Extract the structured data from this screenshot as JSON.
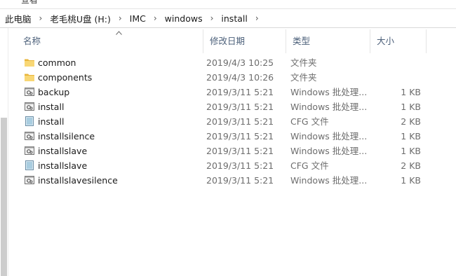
{
  "window": {
    "top_clipped_text": "查看"
  },
  "breadcrumb": {
    "items": [
      "此电脑",
      "老毛桃U盘 (H:)",
      "IMC",
      "windows",
      "install"
    ]
  },
  "columns": {
    "name": "名称",
    "date": "修改日期",
    "type": "类型",
    "size": "大小"
  },
  "files": [
    {
      "icon": "folder-icon",
      "name": "common",
      "date": "2019/4/3 10:25",
      "type": "文件夹",
      "size": ""
    },
    {
      "icon": "folder-icon",
      "name": "components",
      "date": "2019/4/3 10:26",
      "type": "文件夹",
      "size": ""
    },
    {
      "icon": "batch-file-icon",
      "name": "backup",
      "date": "2019/3/11 5:21",
      "type": "Windows 批处理...",
      "size": "1 KB"
    },
    {
      "icon": "batch-file-icon",
      "name": "install",
      "date": "2019/3/11 5:21",
      "type": "Windows 批处理...",
      "size": "1 KB"
    },
    {
      "icon": "cfg-file-icon",
      "name": "install",
      "date": "2019/3/11 5:21",
      "type": "CFG 文件",
      "size": "2 KB"
    },
    {
      "icon": "batch-file-icon",
      "name": "installsilence",
      "date": "2019/3/11 5:21",
      "type": "Windows 批处理...",
      "size": "1 KB"
    },
    {
      "icon": "batch-file-icon",
      "name": "installslave",
      "date": "2019/3/11 5:21",
      "type": "Windows 批处理...",
      "size": "1 KB"
    },
    {
      "icon": "cfg-file-icon",
      "name": "installslave",
      "date": "2019/3/11 5:21",
      "type": "CFG 文件",
      "size": "2 KB"
    },
    {
      "icon": "batch-file-icon",
      "name": "installslavesilence",
      "date": "2019/3/11 5:21",
      "type": "Windows 批处理...",
      "size": "1 KB"
    }
  ]
}
